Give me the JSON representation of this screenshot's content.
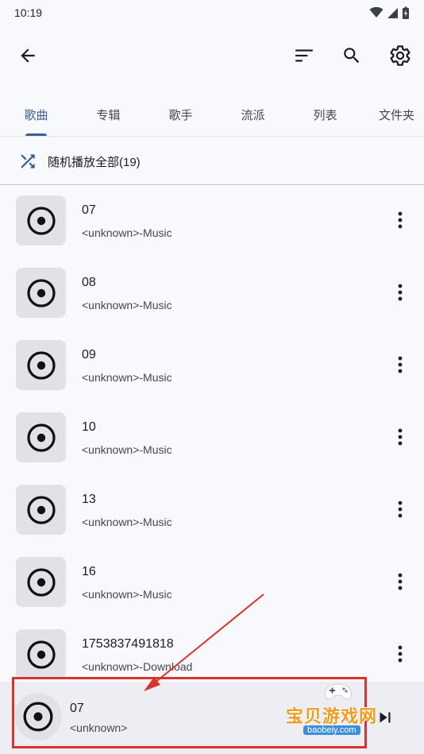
{
  "status_bar": {
    "time": "10:19"
  },
  "tabs": [
    {
      "label": "歌曲",
      "active": true
    },
    {
      "label": "专辑",
      "active": false
    },
    {
      "label": "歌手",
      "active": false
    },
    {
      "label": "流派",
      "active": false
    },
    {
      "label": "列表",
      "active": false
    },
    {
      "label": "文件夹",
      "active": false
    }
  ],
  "shuffle": {
    "label": "随机播放全部(19)"
  },
  "songs": [
    {
      "title": "07",
      "subtitle": "<unknown>-Music"
    },
    {
      "title": "08",
      "subtitle": "<unknown>-Music"
    },
    {
      "title": "09",
      "subtitle": "<unknown>-Music"
    },
    {
      "title": "10",
      "subtitle": "<unknown>-Music"
    },
    {
      "title": "13",
      "subtitle": "<unknown>-Music"
    },
    {
      "title": "16",
      "subtitle": "<unknown>-Music"
    },
    {
      "title": "1753837491818",
      "subtitle": "<unknown>-Download"
    }
  ],
  "mini_player": {
    "title": "07",
    "subtitle": "<unknown>"
  },
  "watermark": {
    "text": "宝贝游戏网",
    "domain": "baobeiy.com"
  },
  "colors": {
    "accent": "#3d5f8f",
    "annotation": "#d9342b",
    "background": "#f8f9fc"
  },
  "icons": {
    "back": "arrow-back-icon",
    "sort": "sort-icon",
    "search": "search-icon",
    "settings": "gear-icon",
    "shuffle": "shuffle-icon",
    "cover": "disc-icon",
    "more": "more-vert-icon",
    "next": "skip-next-icon"
  }
}
